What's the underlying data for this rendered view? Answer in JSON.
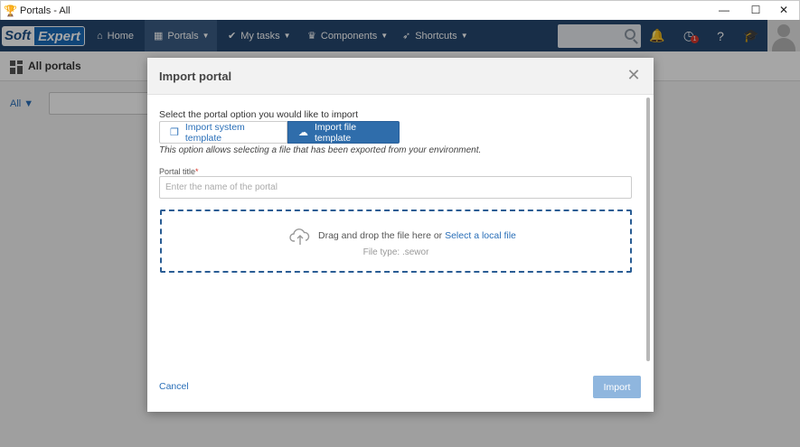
{
  "window": {
    "title": "Portals - All",
    "minimize_glyph": "—",
    "maximize_glyph": "☐",
    "close_glyph": "✕"
  },
  "navbar": {
    "logo_soft": "Soft",
    "logo_expert": "Expert",
    "items": [
      {
        "label": "Home",
        "icon": "home-icon"
      },
      {
        "label": "Portals",
        "icon": "portals-icon"
      },
      {
        "label": "My tasks",
        "icon": "check-icon"
      },
      {
        "label": "Components",
        "icon": "trophy-icon"
      },
      {
        "label": "Shortcuts",
        "icon": "rocket-icon"
      }
    ],
    "notification_badge": "1"
  },
  "page": {
    "title": "All portals",
    "filter_label": "All"
  },
  "modal": {
    "title": "Import portal",
    "option_prompt": "Select the portal option you would like to import",
    "option_system": "Import system template",
    "option_file": "Import file template",
    "help_text": "This option allows selecting a file that has been exported from your environment.",
    "field_label": "Portal title",
    "field_required_mark": "*",
    "field_placeholder": "Enter the name of the portal",
    "drop_text": "Drag and drop the file here or ",
    "drop_link": "Select a local file",
    "file_type": "File type: .sewor",
    "cancel": "Cancel",
    "import": "Import"
  },
  "colors": {
    "navbar": "#25476f",
    "accent": "#2f6dab",
    "link": "#2a6fb8",
    "import_disabled": "#8fb6de"
  }
}
